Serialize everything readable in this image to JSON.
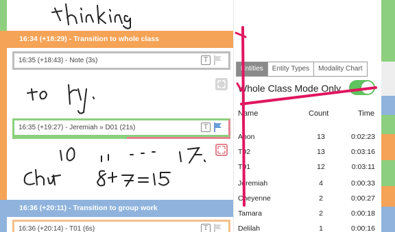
{
  "events": {
    "transition_whole": "16:34 (+18:29) - Transition to whole class",
    "transition_group": "16:36 (+20:11) - Transition to group work"
  },
  "notes": [
    {
      "label": "16:35 (+18:43) - Note (3s)",
      "flag": "grey"
    },
    {
      "label": "16:35 (+19:27) - Jeremiah » D01 (21s)",
      "flag": "blue"
    },
    {
      "label": "16:36 (+20:14) - T01 (6s)",
      "flag": "grey"
    }
  ],
  "note_icon_letter": "T",
  "tabs": [
    "Entities",
    "Entity Types",
    "Modality Chart"
  ],
  "active_tab": "Entities",
  "mode": {
    "label": "Whole Class Mode Only",
    "on": true
  },
  "table": {
    "headers": {
      "name": "Name",
      "count": "Count",
      "time": "Time"
    },
    "rows": [
      {
        "name": "Anon",
        "count": "13",
        "time": "0:02:23"
      },
      {
        "name": "T02",
        "count": "13",
        "time": "0:03:16"
      },
      {
        "name": "T01",
        "count": "12",
        "time": "0:03:11"
      },
      {
        "name": "Jeremiah",
        "count": "4",
        "time": "0:00:33"
      },
      {
        "name": "Cheyenne",
        "count": "2",
        "time": "0:00:27"
      },
      {
        "name": "Tamara",
        "count": "2",
        "time": "0:00:18"
      },
      {
        "name": "Delilah",
        "count": "1",
        "time": "0:00:16"
      }
    ]
  },
  "handwriting": {
    "line1": "thinking",
    "line2": "to ry.",
    "line3": "10 11 - - - 17",
    "line4": "Chat  8+7=15"
  },
  "colors": {
    "orange": "#f5a356",
    "blue": "#8fb3dc",
    "green": "#8ccf7e",
    "red": "#e3838f",
    "ink": "#e0165f",
    "toggle_on": "#5fc35f"
  },
  "icons": [
    "text-note-icon",
    "flag-icon",
    "expand-icon"
  ]
}
